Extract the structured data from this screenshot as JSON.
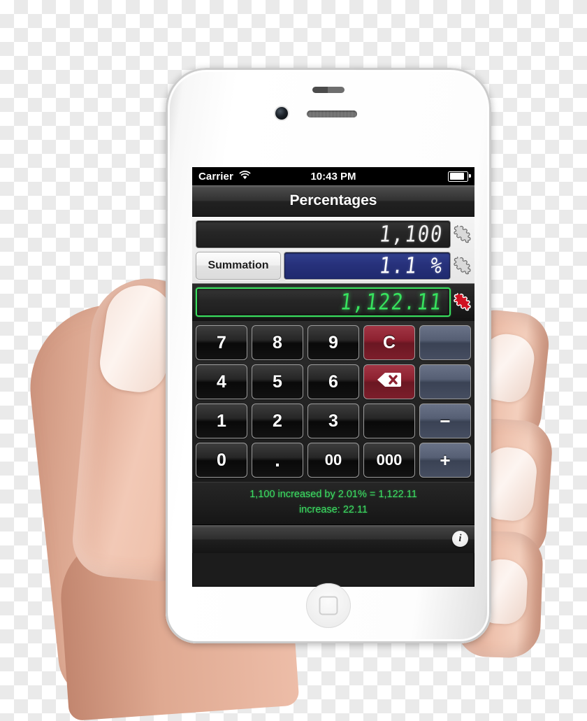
{
  "app": {
    "title": "Percentages"
  },
  "status_bar": {
    "carrier": "Carrier",
    "wifi_icon": "wifi-icon",
    "time": "10:43 PM",
    "battery_icon": "battery-icon"
  },
  "display": {
    "value_label": "1,100",
    "summation_label": "Summation",
    "percent_label": "1.1 %",
    "result_label": "1,122.11",
    "puzzle_icon": "puzzle-piece-icon",
    "result_puzzle_icon": "puzzle-piece-icon-red"
  },
  "keypad": {
    "keys": [
      {
        "label": "7",
        "name": "key-7",
        "style": "dark"
      },
      {
        "label": "8",
        "name": "key-8",
        "style": "dark"
      },
      {
        "label": "9",
        "name": "key-9",
        "style": "dark"
      },
      {
        "label": "C",
        "name": "key-clear",
        "style": "red"
      },
      {
        "label": "",
        "name": "key-blank-1",
        "style": "blue"
      },
      {
        "label": "4",
        "name": "key-4",
        "style": "dark"
      },
      {
        "label": "5",
        "name": "key-5",
        "style": "dark"
      },
      {
        "label": "6",
        "name": "key-6",
        "style": "dark"
      },
      {
        "label": "",
        "name": "key-backspace",
        "style": "red",
        "icon": "backspace-icon"
      },
      {
        "label": "",
        "name": "key-blank-2",
        "style": "blue"
      },
      {
        "label": "1",
        "name": "key-1",
        "style": "dark"
      },
      {
        "label": "2",
        "name": "key-2",
        "style": "dark"
      },
      {
        "label": "3",
        "name": "key-3",
        "style": "dark"
      },
      {
        "label": "",
        "name": "key-blank-3",
        "style": "dark"
      },
      {
        "label": "−",
        "name": "key-minus",
        "style": "blue"
      },
      {
        "label": "0",
        "name": "key-0",
        "style": "dark"
      },
      {
        "label": ".",
        "name": "key-decimal",
        "style": "dark"
      },
      {
        "label": "00",
        "name": "key-double-zero",
        "style": "dark"
      },
      {
        "label": "000",
        "name": "key-triple-zero",
        "style": "dark"
      },
      {
        "label": "+",
        "name": "key-plus",
        "style": "blue"
      }
    ]
  },
  "result_info": {
    "line1": "1,100 increased by 2.01% = 1,122.11",
    "line2": "increase: 22.11"
  },
  "toolbar": {
    "info_label": "i",
    "info_icon": "info-icon"
  },
  "colors": {
    "accent_green": "#37e25e",
    "accent_blue": "#27317b",
    "accent_red": "#8d2130",
    "key_blue": "#565f74"
  },
  "chart_data": null
}
